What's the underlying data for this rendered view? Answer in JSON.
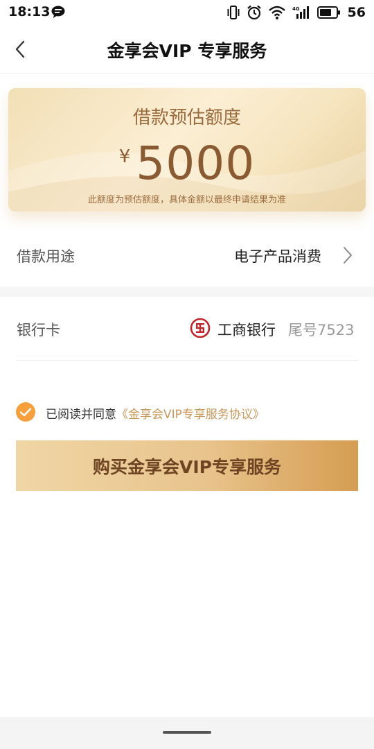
{
  "status_bar": {
    "time": "18:13",
    "battery": "56"
  },
  "header": {
    "title": "金享会VIP 专享服务"
  },
  "quota_card": {
    "title": "借款预估额度",
    "currency": "¥",
    "amount": "5000",
    "note": "此额度为预估额度，具体金额以最终申请结果为准"
  },
  "purpose": {
    "label": "借款用途",
    "value": "电子产品消费"
  },
  "bank": {
    "label": "银行卡",
    "name": "工商银行",
    "tail": "尾号7523",
    "logo_color": "#c0272d"
  },
  "agreement": {
    "checked": true,
    "prefix": "已阅读并同意",
    "link": "《金享会VIP专享服务协议》",
    "check_color": "#f5a03c"
  },
  "buy_button": {
    "label": "购买金享会VIP专享服务"
  },
  "colors": {
    "accent": "#c9975a",
    "button_text": "#6e4423"
  }
}
